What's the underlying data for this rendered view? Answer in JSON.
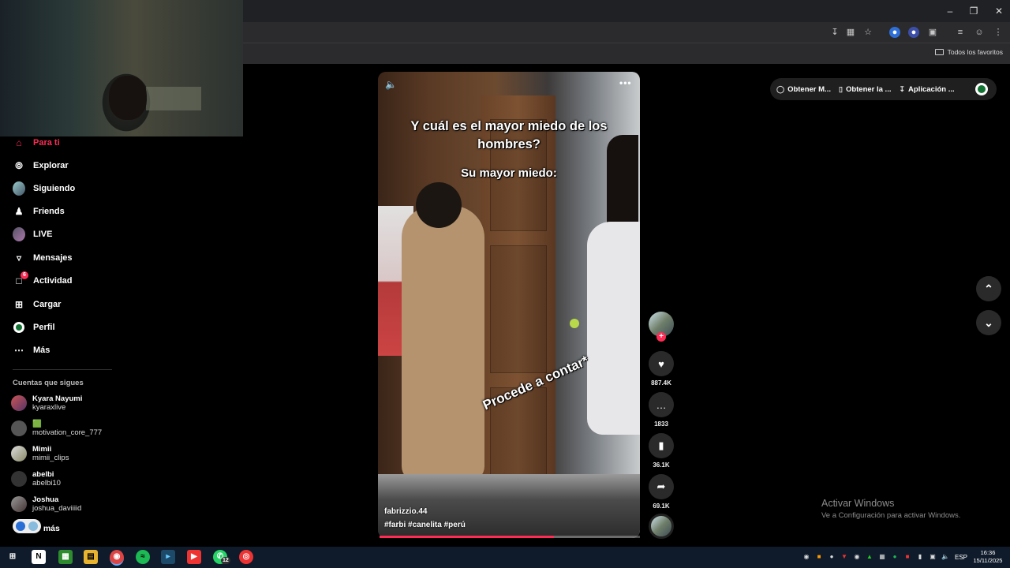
{
  "browser": {
    "bookmarks_folder": "Todos los favoritos",
    "window_controls": [
      "minimize-icon",
      "restore-icon",
      "close-icon"
    ],
    "toolbar_icons": [
      "install-icon",
      "translate-icon",
      "bookmark-star-icon",
      "extension-icon",
      "extension-icon",
      "puzzle-icon",
      "tab-search-icon",
      "account-icon",
      "menu-icon"
    ]
  },
  "sidebar": {
    "nav": [
      {
        "label": "Para ti",
        "icon": "home-icon",
        "active": true
      },
      {
        "label": "Explorar",
        "icon": "compass-icon"
      },
      {
        "label": "Siguiendo",
        "icon": "following-avatar-icon"
      },
      {
        "label": "Friends",
        "icon": "friends-icon"
      },
      {
        "label": "LIVE",
        "icon": "live-icon"
      },
      {
        "label": "Mensajes",
        "icon": "send-icon"
      },
      {
        "label": "Actividad",
        "icon": "activity-icon",
        "badge": "6"
      },
      {
        "label": "Cargar",
        "icon": "upload-icon"
      },
      {
        "label": "Perfil",
        "icon": "profile-icon"
      },
      {
        "label": "Más",
        "icon": "more-icon"
      }
    ],
    "following_title": "Cuentas que sigues",
    "accounts": [
      {
        "name": "Kyara Nayumi",
        "handle": "kyaraxlive"
      },
      {
        "name": "🟩",
        "handle": "motivation_core_777"
      },
      {
        "name": "Mimii",
        "handle": "mimii_clips"
      },
      {
        "name": "abelbi",
        "handle": "abelbi10"
      },
      {
        "name": "Joshua",
        "handle": "joshua_daviiiid"
      }
    ],
    "see_more": "er más"
  },
  "video": {
    "caption_1": "Y cuál es el mayor miedo de los hombres?",
    "caption_2": "Su mayor miedo:",
    "caption_3": "Procede a contar*",
    "author": "fabrizzio.44",
    "tags": "#farbi #canelita #perú",
    "progress": 0.67
  },
  "actions": {
    "likes": "887.4K",
    "comments": "1833",
    "saves": "36.1K",
    "shares": "69.1K"
  },
  "topbar": {
    "pill_1": "Obtener M...",
    "pill_2": "Obtener la ...",
    "pill_3": "Aplicación ..."
  },
  "watermark": {
    "line1": "Activar Windows",
    "line2": "Ve a Configuración para activar Windows."
  },
  "taskbar": {
    "language": "ESP",
    "time": "16:36",
    "date": "15/11/2025",
    "whatsapp_badge": "12"
  },
  "colors": {
    "accent": "#fe2c55",
    "background": "#000000",
    "taskbar": "#0f1b2a"
  }
}
